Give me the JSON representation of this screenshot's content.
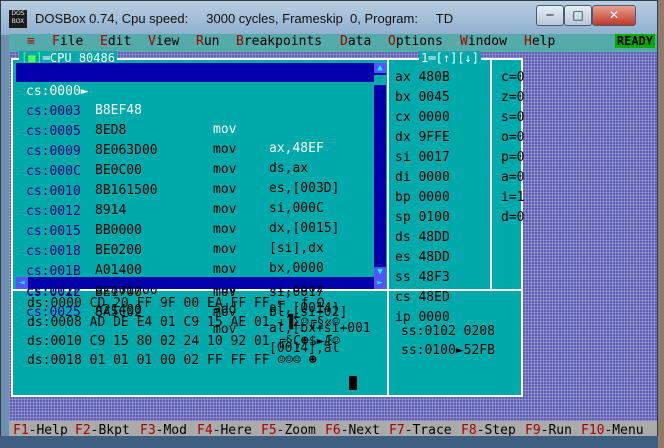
{
  "window": {
    "title": "DOSBox 0.74, Cpu speed:     3000 cycles, Frameskip  0, Program:     TD",
    "app_icon_text": "DOS BOX",
    "minimize_glyph": "─",
    "maximize_glyph": "□",
    "close_glyph": "✕"
  },
  "menu": {
    "system_glyph": "≡",
    "items": [
      {
        "hot": "F",
        "rest": "ile"
      },
      {
        "hot": "E",
        "rest": "dit"
      },
      {
        "hot": "V",
        "rest": "iew"
      },
      {
        "hot": "R",
        "rest": "un"
      },
      {
        "hot": "B",
        "rest": "reakpoints"
      },
      {
        "hot": "D",
        "rest": "ata"
      },
      {
        "hot": "O",
        "rest": "ptions"
      },
      {
        "hot": "W",
        "rest": "indow"
      },
      {
        "hot": "H",
        "rest": "elp"
      }
    ],
    "status": "READY"
  },
  "cpu_window": {
    "close_box": "[■]",
    "title": "CPU 80486",
    "number": "1",
    "zoom_glyphs": "[↑][↓]",
    "disasm": [
      {
        "addr": "cs:0000►",
        "bytes": "B8EF48",
        "op": "mov",
        "args": "ax,48EF"
      },
      {
        "addr": "cs:0003 ",
        "bytes": "8ED8",
        "op": "mov",
        "args": "ds,ax"
      },
      {
        "addr": "cs:0005 ",
        "bytes": "8E063D00",
        "op": "mov",
        "args": "es,[003D]"
      },
      {
        "addr": "cs:0009 ",
        "bytes": "BE0C00",
        "op": "mov",
        "args": "si,000C"
      },
      {
        "addr": "cs:000C ",
        "bytes": "8B161500",
        "op": "mov",
        "args": "dx,[0015]"
      },
      {
        "addr": "cs:0010 ",
        "bytes": "8914",
        "op": "mov",
        "args": "[si],dx"
      },
      {
        "addr": "cs:0012 ",
        "bytes": "BB0000",
        "op": "mov",
        "args": "bx,0000"
      },
      {
        "addr": "cs:0015 ",
        "bytes": "BE0200",
        "op": "mov",
        "args": "si,0002"
      },
      {
        "addr": "cs:0018 ",
        "bytes": "A01400",
        "op": "mov",
        "args": "al,[0014]"
      },
      {
        "addr": "cs:001B ",
        "bytes": "02801700",
        "op": "add",
        "args": "al,[bx+si+001"
      },
      {
        "addr": "cs:001F ",
        "bytes": "A21400",
        "op": "mov",
        "args": "[0014],al"
      },
      {
        "addr": "cs:0022 ",
        "bytes": "BE1700",
        "op": "mov",
        "args": "si,0017"
      },
      {
        "addr": "cs:0025 ",
        "bytes": "8A5C02",
        "op": "mov",
        "args": "bl,[si+02]"
      }
    ],
    "registers": [
      {
        "name": "ax",
        "value": "480B"
      },
      {
        "name": "bx",
        "value": "0045"
      },
      {
        "name": "cx",
        "value": "0000"
      },
      {
        "name": "dx",
        "value": "9FFE"
      },
      {
        "name": "si",
        "value": "0017"
      },
      {
        "name": "di",
        "value": "0000"
      },
      {
        "name": "bp",
        "value": "0000"
      },
      {
        "name": "sp",
        "value": "0100"
      },
      {
        "name": "ds",
        "value": "48DD"
      },
      {
        "name": "es",
        "value": "48DD"
      },
      {
        "name": "ss",
        "value": "48F3"
      },
      {
        "name": "cs",
        "value": "48ED"
      },
      {
        "name": "ip",
        "value": "0000"
      }
    ],
    "flags": [
      "c=0",
      "z=0",
      "s=0",
      "o=0",
      "p=0",
      "a=0",
      "i=1",
      "d=0"
    ],
    "dump": [
      "ds:0000 CD 20 FF 9F 00 EA FF FF =  ƒ Ω",
      "ds:0008 AD DE E4 01 C9 15 AE 01 ↓▐Σ☺╔§«☺",
      "ds:0010 C9 15 80 02 24 10 92 01 ╔§Ç☻$►Æ☺",
      "ds:0018 01 01 01 00 02 FF FF FF ☺☺☺ ☻"
    ],
    "stack": [
      "ss:0102 0208",
      "ss:0100►52FB"
    ]
  },
  "function_keys": [
    {
      "key": "F1",
      "label": "-Help"
    },
    {
      "key": "F2",
      "label": "-Bkpt"
    },
    {
      "key": "F3",
      "label": "-Mod"
    },
    {
      "key": "F4",
      "label": "-Here"
    },
    {
      "key": "F5",
      "label": "-Zoom"
    },
    {
      "key": "F6",
      "label": "-Next"
    },
    {
      "key": "F7",
      "label": "-Trace"
    },
    {
      "key": "F8",
      "label": "-Step"
    },
    {
      "key": "F9",
      "label": "-Run"
    },
    {
      "key": "F10",
      "label": "-Menu"
    }
  ],
  "colors": {
    "panel": "#00aaaa",
    "selection": "#0000aa",
    "hotkey": "#aa0000",
    "ready": "#00aa00"
  }
}
